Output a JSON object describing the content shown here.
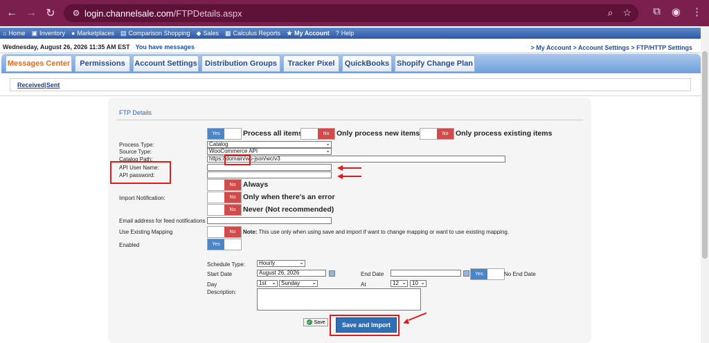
{
  "browser": {
    "url_host": "login.channelsale.com",
    "url_path": "/FTPDetails.aspx"
  },
  "menu": [
    {
      "label": "Home"
    },
    {
      "label": "Inventory"
    },
    {
      "label": "Marketplaces"
    },
    {
      "label": "Comparison Shopping"
    },
    {
      "label": "Sales"
    },
    {
      "label": "Calculus Reports"
    },
    {
      "label": "My Account"
    },
    {
      "label": "Help"
    }
  ],
  "status": {
    "date": "Wednesday, August 26, 2026 11:35 AM EST",
    "messages": "You have messages",
    "breadcrumb": "> My Account > Account Settings > FTP/HTTP Settings"
  },
  "tabs": [
    {
      "label": "Messages Center"
    },
    {
      "label": "Permissions"
    },
    {
      "label": "Account Settings"
    },
    {
      "label": "Distribution Groups"
    },
    {
      "label": "Tracker Pixel"
    },
    {
      "label": "QuickBooks"
    },
    {
      "label": "Shopify Change Plan"
    }
  ],
  "subnav": {
    "received": "Received",
    "sep": "|",
    "sent": "Sent"
  },
  "form": {
    "title": "FTP Details",
    "process_all": "Process all items",
    "process_new": "Only process new items",
    "process_existing": "Only process existing items",
    "yes": "Yes",
    "no": "No",
    "process_type_label": "Process Type:",
    "process_type_value": "Catalog",
    "source_type_label": "Source Type:",
    "source_type_value": "WooCommerce API",
    "catalog_path_label": "Catalog Path:",
    "catalog_path_prefix": "https://",
    "catalog_path_domain": "domain/",
    "catalog_path_suffix": "wp-json/wc/v3",
    "api_user_label": "API User Name:",
    "api_password_label": "API password:",
    "import_notification_label": "Import Notification:",
    "notify_always": "Always",
    "notify_error": "Only when there's an error",
    "notify_never": "Never (Not recommended)",
    "email_label": "Email address for feed notifications",
    "mapping_label": "Use Existing Mapping",
    "note_bold": "Note:",
    "note_text": " This use only when using save and import if want to change mapping or want to use existing mapping.",
    "enabled_label": "Enabled",
    "schedule_type_label": "Schedule Type:",
    "schedule_type_value": "Hourly",
    "start_date_label": "Start Date",
    "start_date_value": "August 26, 2026",
    "end_date_label": "End Date",
    "no_end_date": "No End Date",
    "day_label": "Day",
    "day_value": "1st",
    "weekday_value": "Sunday",
    "at_label": "At",
    "hour_value": "12",
    "minute_value": "10",
    "description_label": "Description:",
    "save": "Save",
    "save_import": "Save and Import"
  },
  "colors": {
    "chrome": "#7a1f4e",
    "accent_tab": "#e06a1a",
    "toggle_yes": "#4a86c8",
    "toggle_no": "#d24b4b",
    "annotation": "#e01a1a"
  }
}
